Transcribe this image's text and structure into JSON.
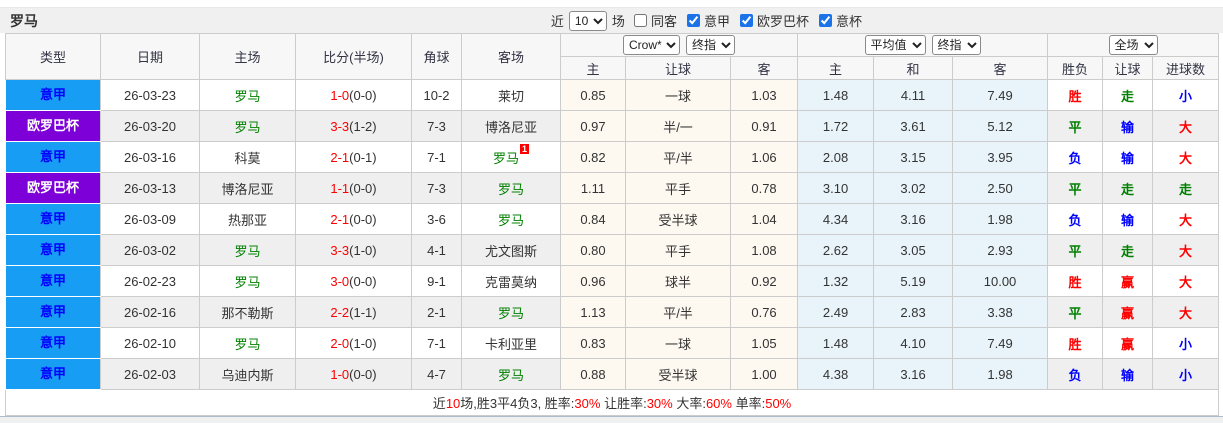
{
  "toolbar": {
    "title": "罗马",
    "recent_prefix": "近",
    "recent_value": "10",
    "recent_suffix": "场",
    "checkboxes": [
      {
        "label": "同客",
        "checked": false
      },
      {
        "label": "意甲",
        "checked": true
      },
      {
        "label": "欧罗巴杯",
        "checked": true
      },
      {
        "label": "意杯",
        "checked": true
      }
    ]
  },
  "table": {
    "left_columns": [
      "类型",
      "日期",
      "主场",
      "比分(半场)",
      "角球",
      "客场"
    ],
    "asian_group": {
      "selects": [
        "Crow*",
        "终指"
      ],
      "sub": [
        "主",
        "让球",
        "客"
      ]
    },
    "euro_group": {
      "selects": [
        "平均值",
        "终指"
      ],
      "sub": [
        "主",
        "和",
        "客"
      ]
    },
    "result_group": {
      "select": "全场",
      "sub": [
        "胜负",
        "让球",
        "进球数"
      ]
    },
    "colors": {
      "league_blue": "#189df5",
      "league_purple": "#7d00d8",
      "roma_green": "#008000",
      "score_red": "#ff0000",
      "win_red": "#ff0000",
      "draw_green": "#008000",
      "loss_blue": "#0000ff",
      "asian_cell_bg": "#fdf8f0",
      "euro_cell_bg": "#e9f4fa"
    },
    "rows": [
      {
        "league": "意甲",
        "league_color": "blue",
        "date": "26-03-23",
        "home": "罗马",
        "home_roma": true,
        "score": "1-0",
        "half": "(0-0)",
        "corners": "10-2",
        "away": "莱切",
        "away_roma": false,
        "away_sup": "",
        "asian": [
          "0.85",
          "一球",
          "1.03"
        ],
        "euro": [
          "1.48",
          "4.11",
          "7.49"
        ],
        "wdl": {
          "t": "胜",
          "c": "red"
        },
        "handicap": {
          "t": "走",
          "c": "green"
        },
        "goals": {
          "t": "小",
          "c": "blue"
        }
      },
      {
        "league": "欧罗巴杯",
        "league_color": "purple",
        "date": "26-03-20",
        "home": "罗马",
        "home_roma": true,
        "score": "3-3",
        "half": "(1-2)",
        "corners": "7-3",
        "away": "博洛尼亚",
        "away_roma": false,
        "away_sup": "",
        "asian": [
          "0.97",
          "半/一",
          "0.91"
        ],
        "euro": [
          "1.72",
          "3.61",
          "5.12"
        ],
        "wdl": {
          "t": "平",
          "c": "green"
        },
        "handicap": {
          "t": "输",
          "c": "blue"
        },
        "goals": {
          "t": "大",
          "c": "red"
        }
      },
      {
        "league": "意甲",
        "league_color": "blue",
        "date": "26-03-16",
        "home": "科莫",
        "home_roma": false,
        "score": "2-1",
        "half": "(0-1)",
        "corners": "7-1",
        "away": "罗马",
        "away_roma": true,
        "away_sup": "1",
        "asian": [
          "0.82",
          "平/半",
          "1.06"
        ],
        "euro": [
          "2.08",
          "3.15",
          "3.95"
        ],
        "wdl": {
          "t": "负",
          "c": "blue"
        },
        "handicap": {
          "t": "输",
          "c": "blue"
        },
        "goals": {
          "t": "大",
          "c": "red"
        }
      },
      {
        "league": "欧罗巴杯",
        "league_color": "purple",
        "date": "26-03-13",
        "home": "博洛尼亚",
        "home_roma": false,
        "score": "1-1",
        "half": "(0-0)",
        "corners": "7-3",
        "away": "罗马",
        "away_roma": true,
        "away_sup": "",
        "asian": [
          "1.11",
          "平手",
          "0.78"
        ],
        "euro": [
          "3.10",
          "3.02",
          "2.50"
        ],
        "wdl": {
          "t": "平",
          "c": "green"
        },
        "handicap": {
          "t": "走",
          "c": "green"
        },
        "goals": {
          "t": "走",
          "c": "green"
        }
      },
      {
        "league": "意甲",
        "league_color": "blue",
        "date": "26-03-09",
        "home": "热那亚",
        "home_roma": false,
        "score": "2-1",
        "half": "(0-0)",
        "corners": "3-6",
        "away": "罗马",
        "away_roma": true,
        "away_sup": "",
        "asian": [
          "0.84",
          "受半球",
          "1.04"
        ],
        "euro": [
          "4.34",
          "3.16",
          "1.98"
        ],
        "wdl": {
          "t": "负",
          "c": "blue"
        },
        "handicap": {
          "t": "输",
          "c": "blue"
        },
        "goals": {
          "t": "大",
          "c": "red"
        }
      },
      {
        "league": "意甲",
        "league_color": "blue",
        "date": "26-03-02",
        "home": "罗马",
        "home_roma": true,
        "score": "3-3",
        "half": "(1-0)",
        "corners": "4-1",
        "away": "尤文图斯",
        "away_roma": false,
        "away_sup": "",
        "asian": [
          "0.80",
          "平手",
          "1.08"
        ],
        "euro": [
          "2.62",
          "3.05",
          "2.93"
        ],
        "wdl": {
          "t": "平",
          "c": "green"
        },
        "handicap": {
          "t": "走",
          "c": "green"
        },
        "goals": {
          "t": "大",
          "c": "red"
        }
      },
      {
        "league": "意甲",
        "league_color": "blue",
        "date": "26-02-23",
        "home": "罗马",
        "home_roma": true,
        "score": "3-0",
        "half": "(0-0)",
        "corners": "9-1",
        "away": "克雷莫纳",
        "away_roma": false,
        "away_sup": "",
        "asian": [
          "0.96",
          "球半",
          "0.92"
        ],
        "euro": [
          "1.32",
          "5.19",
          "10.00"
        ],
        "wdl": {
          "t": "胜",
          "c": "red"
        },
        "handicap": {
          "t": "赢",
          "c": "red"
        },
        "goals": {
          "t": "大",
          "c": "red"
        }
      },
      {
        "league": "意甲",
        "league_color": "blue",
        "date": "26-02-16",
        "home": "那不勒斯",
        "home_roma": false,
        "score": "2-2",
        "half": "(1-1)",
        "corners": "2-1",
        "away": "罗马",
        "away_roma": true,
        "away_sup": "",
        "asian": [
          "1.13",
          "平/半",
          "0.76"
        ],
        "euro": [
          "2.49",
          "2.83",
          "3.38"
        ],
        "wdl": {
          "t": "平",
          "c": "green"
        },
        "handicap": {
          "t": "赢",
          "c": "red"
        },
        "goals": {
          "t": "大",
          "c": "red"
        }
      },
      {
        "league": "意甲",
        "league_color": "blue",
        "date": "26-02-10",
        "home": "罗马",
        "home_roma": true,
        "score": "2-0",
        "half": "(1-0)",
        "corners": "7-1",
        "away": "卡利亚里",
        "away_roma": false,
        "away_sup": "",
        "asian": [
          "0.83",
          "一球",
          "1.05"
        ],
        "euro": [
          "1.48",
          "4.10",
          "7.49"
        ],
        "wdl": {
          "t": "胜",
          "c": "red"
        },
        "handicap": {
          "t": "赢",
          "c": "red"
        },
        "goals": {
          "t": "小",
          "c": "blue"
        }
      },
      {
        "league": "意甲",
        "league_color": "blue",
        "date": "26-02-03",
        "home": "乌迪内斯",
        "home_roma": false,
        "score": "1-0",
        "half": "(0-0)",
        "corners": "4-7",
        "away": "罗马",
        "away_roma": true,
        "away_sup": "",
        "asian": [
          "0.88",
          "受半球",
          "1.00"
        ],
        "euro": [
          "4.38",
          "3.16",
          "1.98"
        ],
        "wdl": {
          "t": "负",
          "c": "blue"
        },
        "handicap": {
          "t": "输",
          "c": "blue"
        },
        "goals": {
          "t": "小",
          "c": "blue"
        }
      }
    ]
  },
  "summary": {
    "segments": [
      {
        "t": "近",
        "c": "dark"
      },
      {
        "t": "10",
        "c": "red"
      },
      {
        "t": "场,胜3平4负3, 胜率:",
        "c": "dark"
      },
      {
        "t": "30%",
        "c": "red"
      },
      {
        "t": " 让胜率:",
        "c": "dark"
      },
      {
        "t": "30%",
        "c": "red"
      },
      {
        "t": " 大率:",
        "c": "dark"
      },
      {
        "t": "60%",
        "c": "red"
      },
      {
        "t": " 单率:",
        "c": "dark"
      },
      {
        "t": "50%",
        "c": "red"
      }
    ]
  }
}
